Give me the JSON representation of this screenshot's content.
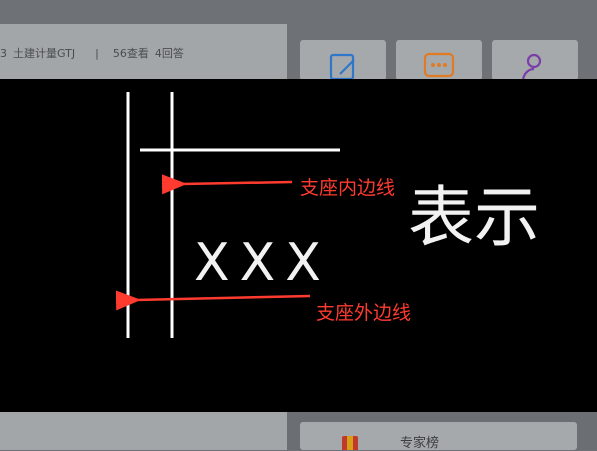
{
  "question": {
    "meta": {
      "prefix": "3",
      "category": "土建计量GTJ",
      "separator": "|",
      "views": "56查看",
      "answers": "4回答"
    }
  },
  "sidebar": {
    "cards": [
      {
        "icon": "edit-icon",
        "color": "#2e77c9"
      },
      {
        "icon": "chat-icon",
        "color": "#e07b24"
      },
      {
        "icon": "user-add-icon",
        "color": "#7a3ea8"
      }
    ],
    "ranking_label": "专家榜"
  },
  "image": {
    "annotations": {
      "inner_edge": "支座内边线",
      "outer_edge": "支座外边线"
    },
    "drawing_text": "XXX",
    "handwriting": "表示",
    "colors": {
      "annotation": "#ff3b30",
      "lines": "#ffffff",
      "background": "#000000"
    }
  }
}
